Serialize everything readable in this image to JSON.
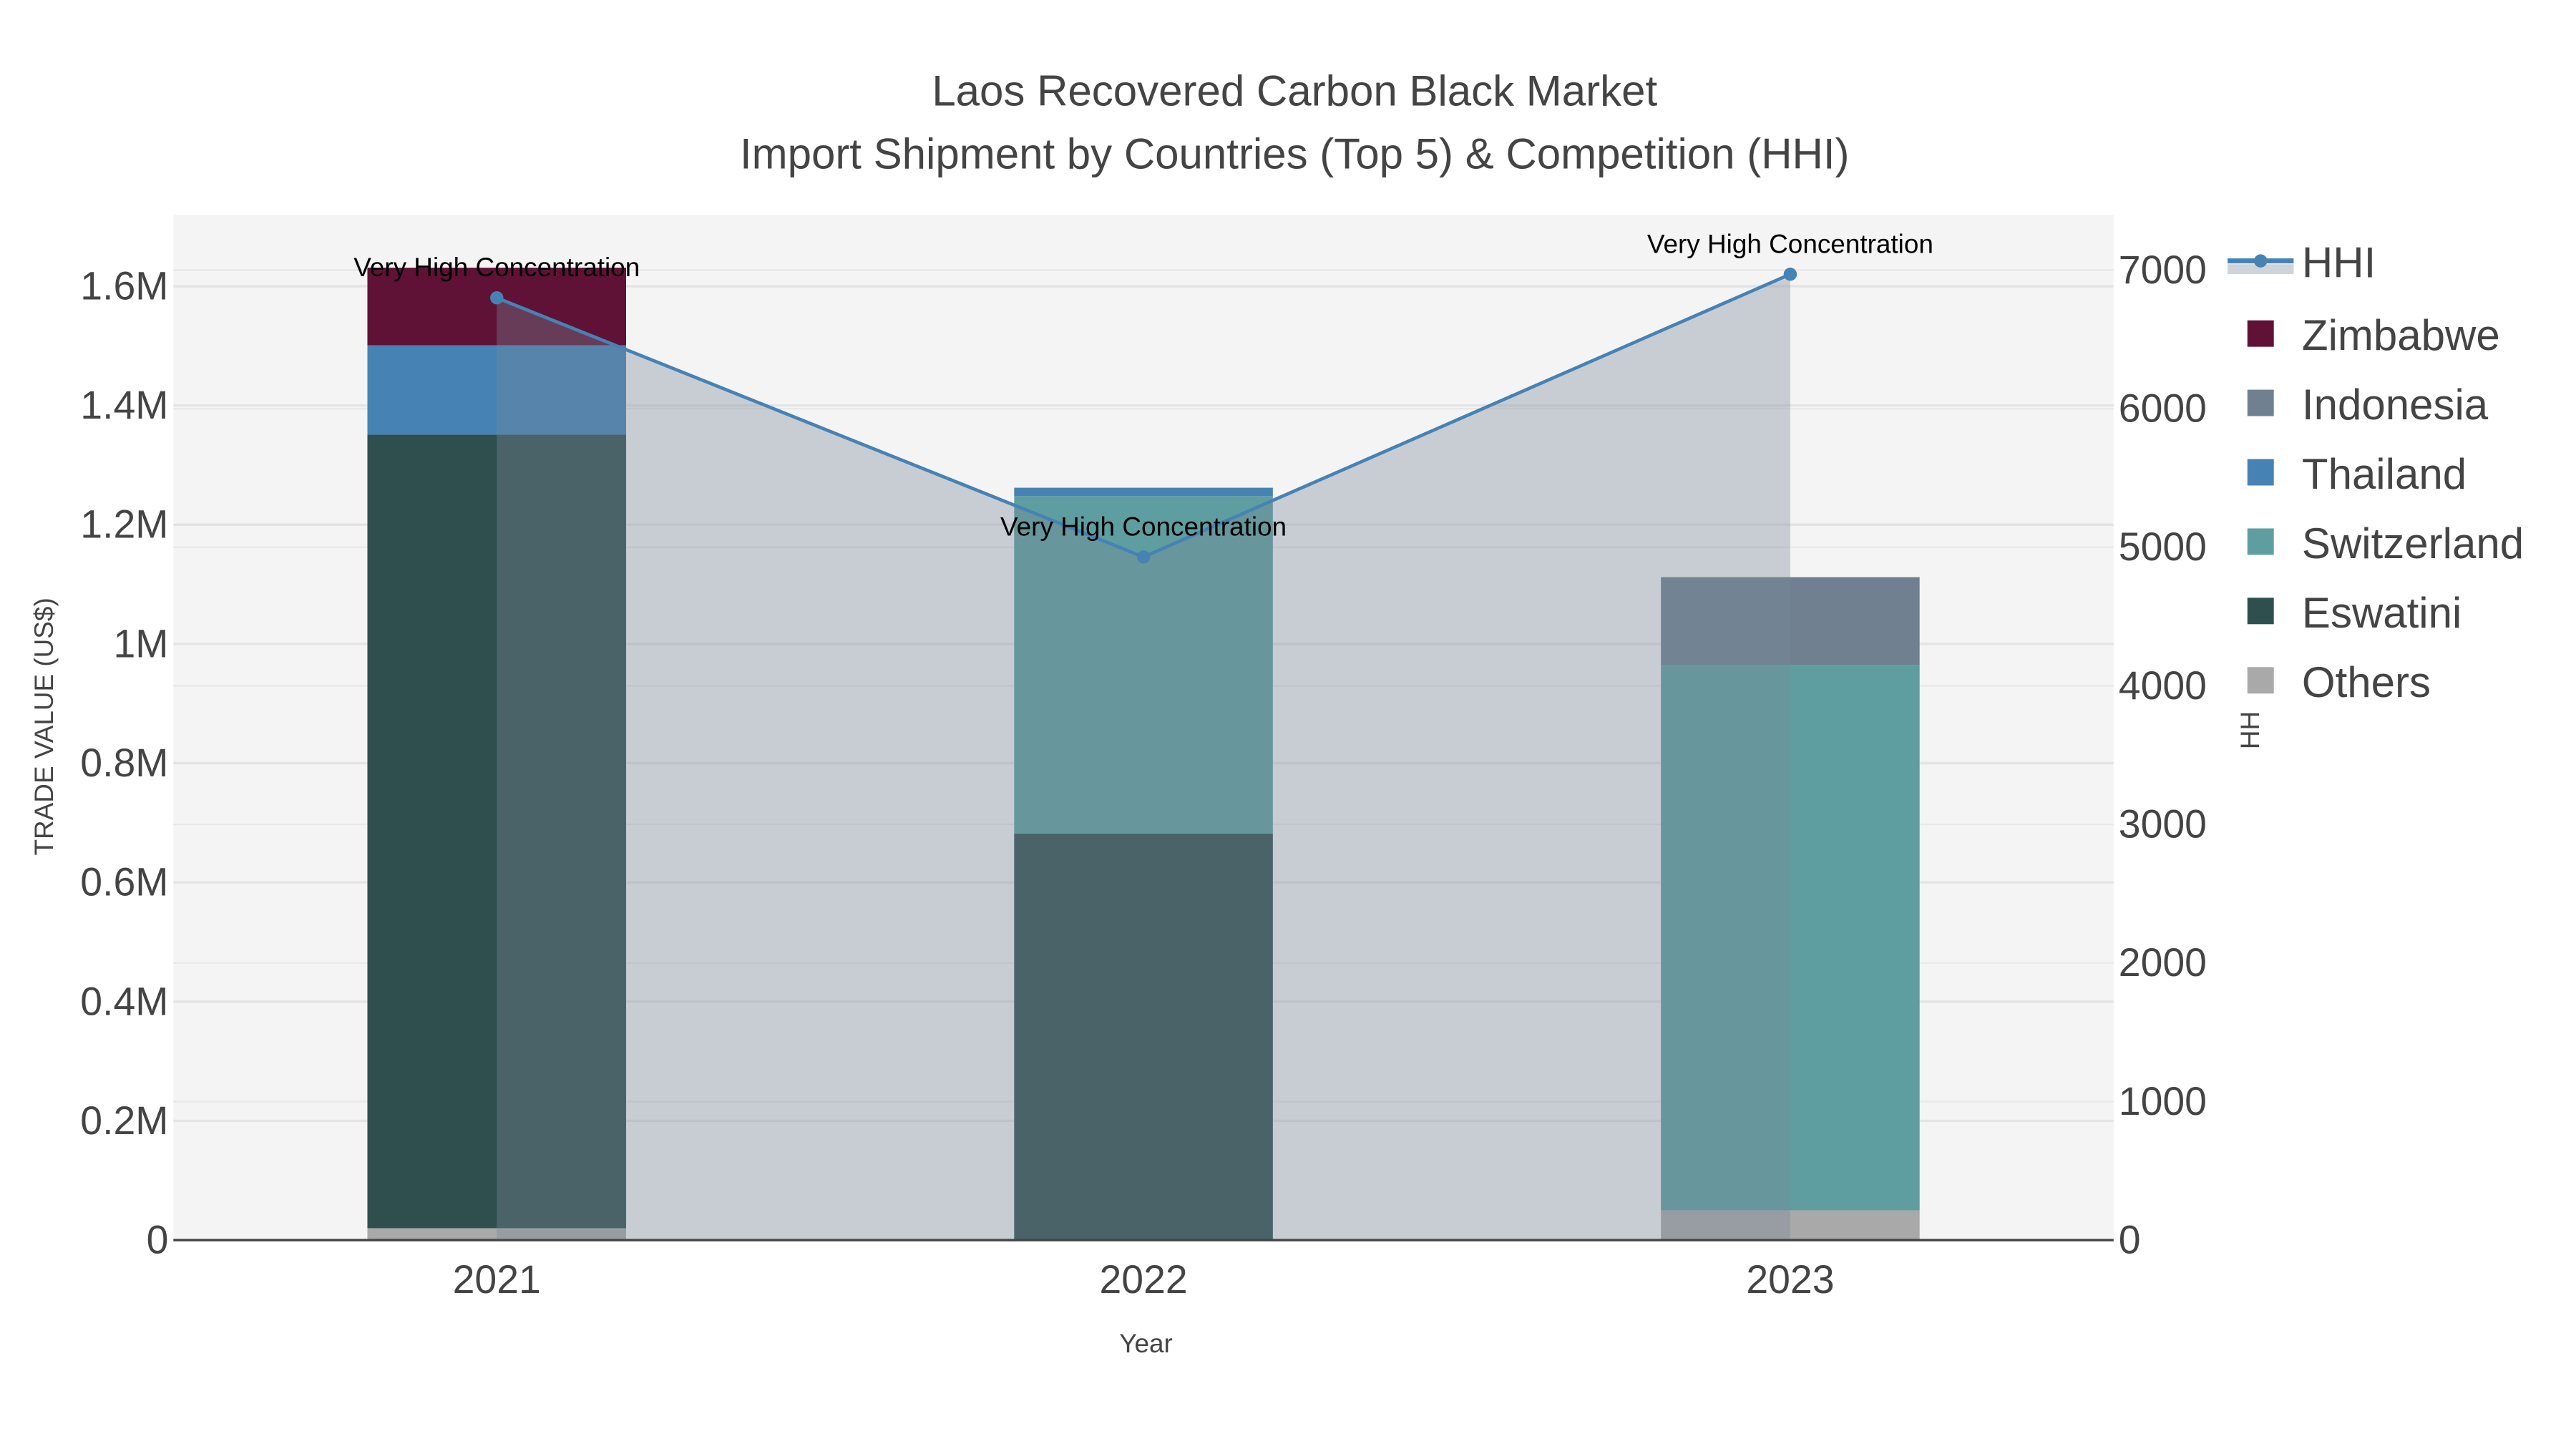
{
  "chart_data": {
    "type": "bar",
    "title": "Laos Recovered Carbon Black Market",
    "subtitle": "Import Shipment by Countries (Top 5) & Competition (HHI)",
    "xlabel": "Year",
    "ylabel": "TRADE VALUE (US$)",
    "y2label": "HHI",
    "categories": [
      "2021",
      "2022",
      "2023"
    ],
    "ylim": [
      0,
      1720000
    ],
    "y2lim": [
      0,
      7400
    ],
    "yticks": [
      0,
      200000,
      400000,
      600000,
      800000,
      1000000,
      1200000,
      1400000,
      1600000
    ],
    "ytick_labels": [
      "0",
      "0.2M",
      "0.4M",
      "0.6M",
      "0.8M",
      "1M",
      "1.2M",
      "1.4M",
      "1.6M"
    ],
    "y2ticks": [
      0,
      1000,
      2000,
      3000,
      4000,
      5000,
      6000,
      7000
    ],
    "y2tick_labels": [
      "0",
      "1000",
      "2000",
      "3000",
      "4000",
      "5000",
      "6000",
      "7000"
    ],
    "grid": true,
    "legend_position": "right",
    "stack_order": [
      "Others",
      "Eswatini",
      "Switzerland",
      "Thailand",
      "Indonesia",
      "Zimbabwe"
    ],
    "series": [
      {
        "name": "Zimbabwe",
        "color": "#5f1236",
        "values": [
          130000,
          0,
          0
        ]
      },
      {
        "name": "Indonesia",
        "color": "#708090",
        "values": [
          0,
          0,
          147000
        ]
      },
      {
        "name": "Thailand",
        "color": "#4682b4",
        "values": [
          150000,
          14000,
          0
        ]
      },
      {
        "name": "Switzerland",
        "color": "#5f9ea0",
        "values": [
          0,
          566000,
          915000
        ]
      },
      {
        "name": "Eswatini",
        "color": "#2f4f4f",
        "values": [
          1331000,
          682000,
          0
        ]
      },
      {
        "name": "Others",
        "color": "#a9a9a9",
        "values": [
          20000,
          0,
          50000
        ]
      }
    ],
    "hhi": {
      "name": "HHI",
      "color": "#4682b4",
      "fill": "rgba(119,136,153,0.36)",
      "values": [
        6800,
        4930,
        6970
      ],
      "annotations": [
        "Very High Concentration",
        "Very High Concentration",
        "Very High Concentration"
      ]
    }
  }
}
